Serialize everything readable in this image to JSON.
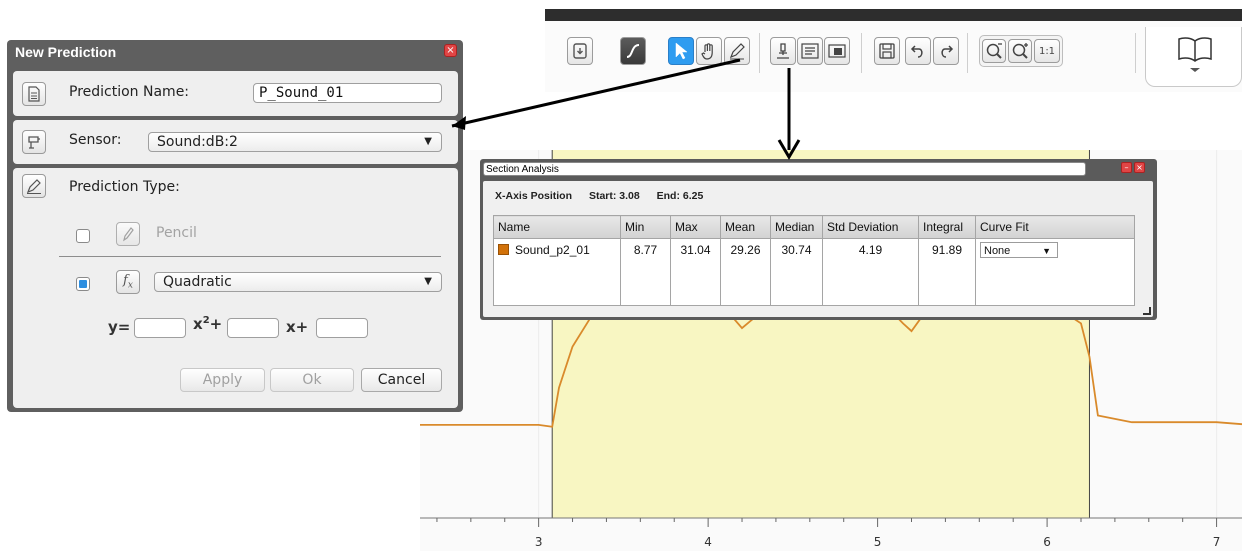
{
  "toolbar": {
    "buttons": [
      {
        "name": "import-icon"
      },
      {
        "name": "curve-icon"
      },
      {
        "name": "select-pointer-icon"
      },
      {
        "name": "hand-pan-icon"
      },
      {
        "name": "prediction-pencil-icon"
      },
      {
        "name": "microscope-analysis-icon"
      },
      {
        "name": "notes-icon"
      },
      {
        "name": "snapshot-icon"
      },
      {
        "name": "save-icon"
      },
      {
        "name": "undo-icon"
      },
      {
        "name": "redo-icon"
      },
      {
        "name": "zoom-out-icon"
      },
      {
        "name": "zoom-in-icon"
      },
      {
        "name": "journal-book-icon"
      }
    ],
    "zoom_reset_label": "1:1"
  },
  "new_prediction": {
    "title": "New Prediction",
    "name_label": "Prediction Name:",
    "name_value": "P_Sound_01",
    "sensor_label": "Sensor:",
    "sensor_value": "Sound:dB:2",
    "type_label": "Prediction Type:",
    "pencil_label": "Pencil",
    "pencil_checked": false,
    "quadratic_checked": true,
    "curve_value": "Quadratic",
    "equation": {
      "y": "y=",
      "x2": "x",
      "x2_sup": "2",
      "plus1": "+",
      "x1": "x+"
    },
    "coefficients": {
      "a": "",
      "b": "",
      "c": ""
    },
    "buttons": {
      "apply": "Apply",
      "ok": "Ok",
      "cancel": "Cancel"
    }
  },
  "section_analysis": {
    "title": "Section Analysis",
    "axis_label": "X-Axis Position",
    "start": "Start: 3.08",
    "end": "End: 6.25",
    "columns": [
      "Name",
      "Min",
      "Max",
      "Mean",
      "Median",
      "Std Deviation",
      "Integral",
      "Curve Fit"
    ],
    "row": {
      "name": "Sound_p2_01",
      "min": "8.77",
      "max": "31.04",
      "mean": "29.26",
      "median": "30.74",
      "std": "4.19",
      "integral": "91.89",
      "curve_fit": "None",
      "color": "#d2720a"
    }
  },
  "chart_data": {
    "type": "line",
    "x_ticks": [
      "3",
      "4",
      "5",
      "6",
      "7"
    ],
    "xlim": [
      2.3,
      7.15
    ],
    "ylim": [
      0,
      35
    ],
    "selection": [
      3.08,
      6.25
    ],
    "series": [
      {
        "color": "#d98a2b",
        "x": [
          2.3,
          3.0,
          3.08,
          3.12,
          3.2,
          3.3,
          3.4,
          3.5,
          4.0,
          4.15,
          4.2,
          4.25,
          4.3,
          4.4,
          5.0,
          5.1,
          5.15,
          5.2,
          5.25,
          5.3,
          5.4,
          6.1,
          6.2,
          6.25,
          6.3,
          6.5,
          7.0,
          7.15
        ],
        "y": [
          8.77,
          8.77,
          8.4,
          16,
          24,
          29.3,
          30.8,
          30.8,
          30.8,
          29.5,
          27.6,
          29.0,
          30.3,
          30.7,
          31.0,
          30.2,
          28.5,
          27.0,
          29.3,
          30.3,
          30.7,
          30.7,
          28.5,
          22,
          10.6,
          9.3,
          9.3,
          8.9
        ]
      }
    ]
  }
}
